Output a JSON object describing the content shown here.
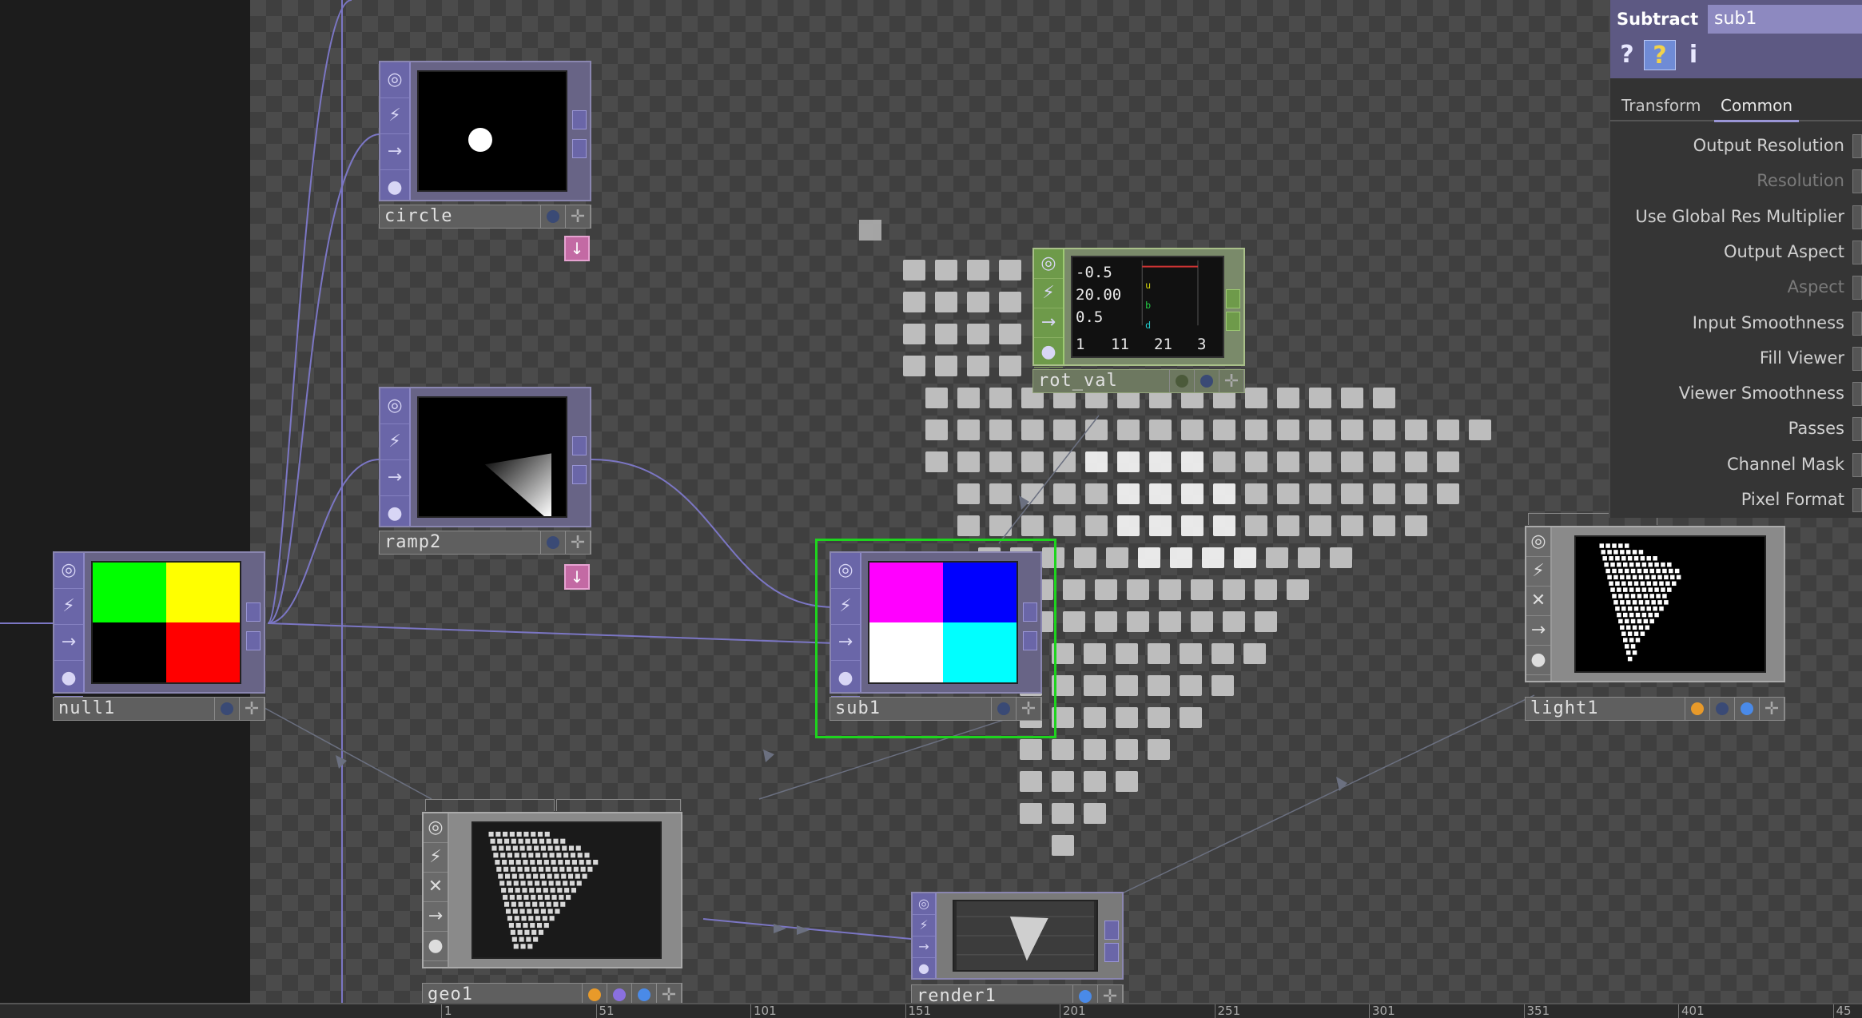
{
  "nodes": {
    "circle": {
      "name": "circle"
    },
    "ramp2": {
      "name": "ramp2"
    },
    "null1": {
      "name": "null1"
    },
    "sub1": {
      "name": "sub1"
    },
    "rot_val": {
      "name": "rot_val",
      "values": [
        "-0.5",
        "20.00",
        "0.5"
      ],
      "ticks": [
        "1",
        "11",
        "21",
        "3"
      ]
    },
    "geo1": {
      "name": "geo1"
    },
    "render1": {
      "name": "render1"
    },
    "light1": {
      "name": "light1"
    }
  },
  "panel": {
    "op_type": "Subtract",
    "op_name": "sub1",
    "icons": [
      "help-icon",
      "help-wizard-icon",
      "info-icon"
    ],
    "icon_glyphs": [
      "?",
      "?",
      "i"
    ],
    "tabs": [
      "Transform",
      "Common"
    ],
    "active_tab": "Common",
    "params": [
      {
        "label": "Output Resolution",
        "enabled": true
      },
      {
        "label": "Resolution",
        "enabled": false
      },
      {
        "label": "Use Global Res Multiplier",
        "enabled": true
      },
      {
        "label": "Output Aspect",
        "enabled": true
      },
      {
        "label": "Aspect",
        "enabled": false
      },
      {
        "label": "Input Smoothness",
        "enabled": true
      },
      {
        "label": "Fill Viewer",
        "enabled": true
      },
      {
        "label": "Viewer Smoothness",
        "enabled": true
      },
      {
        "label": "Passes",
        "enabled": true
      },
      {
        "label": "Channel Mask",
        "enabled": true
      },
      {
        "label": "Pixel Format",
        "enabled": true
      }
    ]
  },
  "timeline": {
    "ticks": [
      "1",
      "51",
      "101",
      "151",
      "201",
      "251",
      "301",
      "351",
      "401",
      "45"
    ]
  },
  "colors": {
    "selected": "#1ed41e",
    "op_strip": "#6a66a8",
    "panel_header": "#5d5983"
  }
}
